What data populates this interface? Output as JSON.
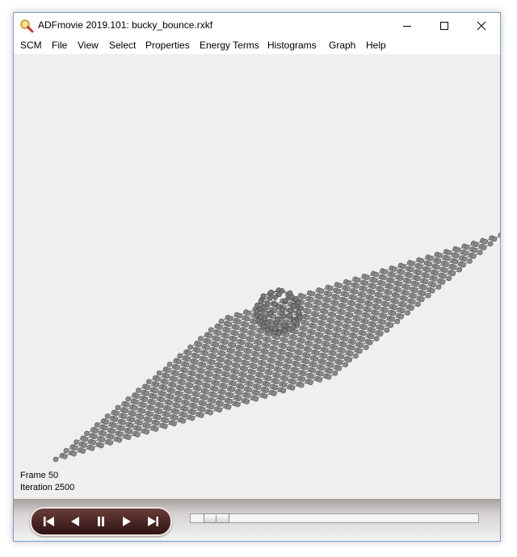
{
  "window": {
    "title": "ADFmovie 2019.101: bucky_bounce.rxkf"
  },
  "menu": [
    "SCM",
    "File",
    "View",
    "Select",
    "Properties",
    "Energy Terms",
    "Histograms",
    "Graph",
    "Help"
  ],
  "info": {
    "frame": "Frame 50",
    "iteration": "Iteration 2500"
  },
  "player": {
    "slider_position": 0.05
  },
  "icons": {
    "app": "magnifier-icon",
    "minimize": "minimize-icon",
    "maximize": "maximize-icon",
    "close": "close-icon",
    "first": "skip-first-icon",
    "back": "step-back-icon",
    "pause": "pause-icon",
    "forward": "play-icon",
    "last": "skip-last-icon"
  },
  "colors": {
    "viewport_bg": "#efefef",
    "atom": "#8a8a8a",
    "bond": "#7d7d7d",
    "player": "#4a2020"
  }
}
